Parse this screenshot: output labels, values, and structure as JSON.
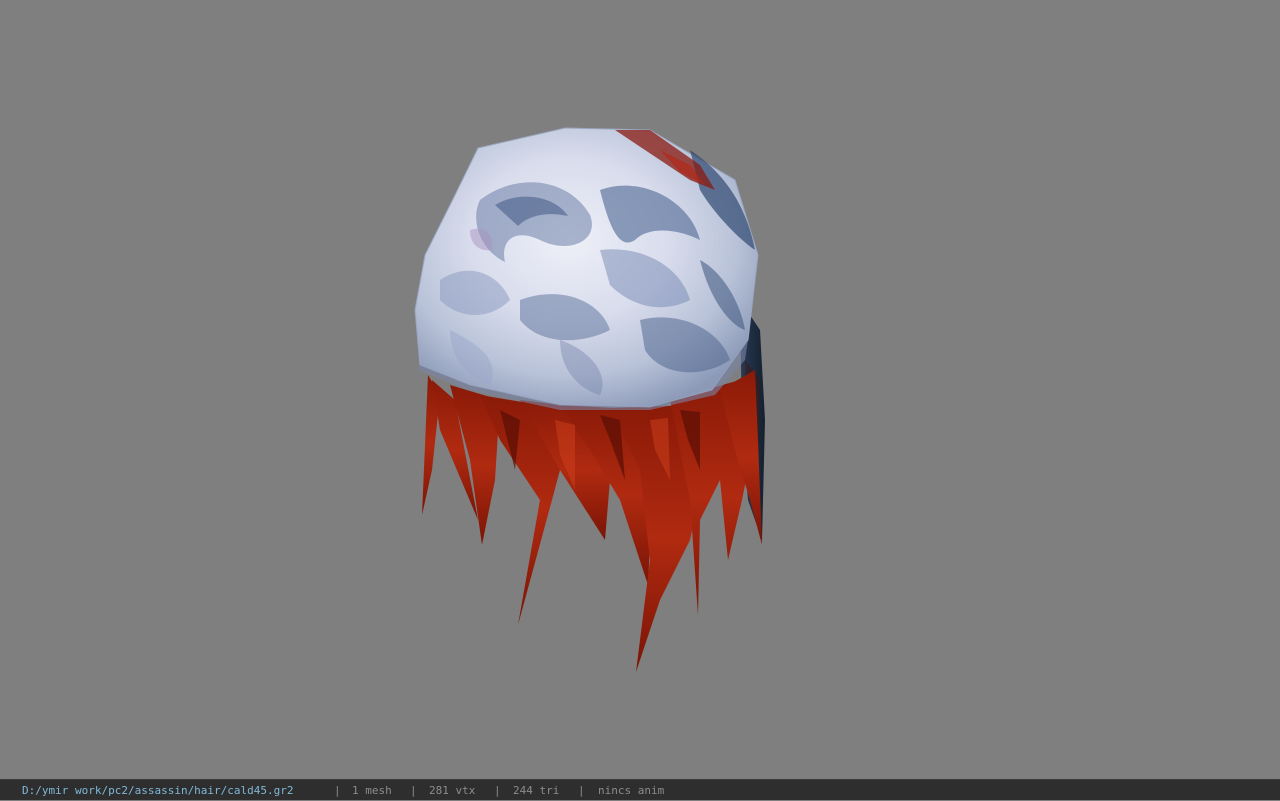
{
  "viewer": {
    "background_color": "#7f7f7f",
    "model_description": "hair mesh with white/blue marbled cap and red strands"
  },
  "status_bar": {
    "file_path": "D:/ymir work/pc2/assassin/hair/cald45.gr2",
    "mesh_count": "1 mesh",
    "vertex_count": "281 vtx",
    "triangle_count": "244 tri",
    "anim": "nincs anim",
    "separator": "|",
    "path_color": "#7fb8d8",
    "text_color": "#8c8c8c"
  }
}
